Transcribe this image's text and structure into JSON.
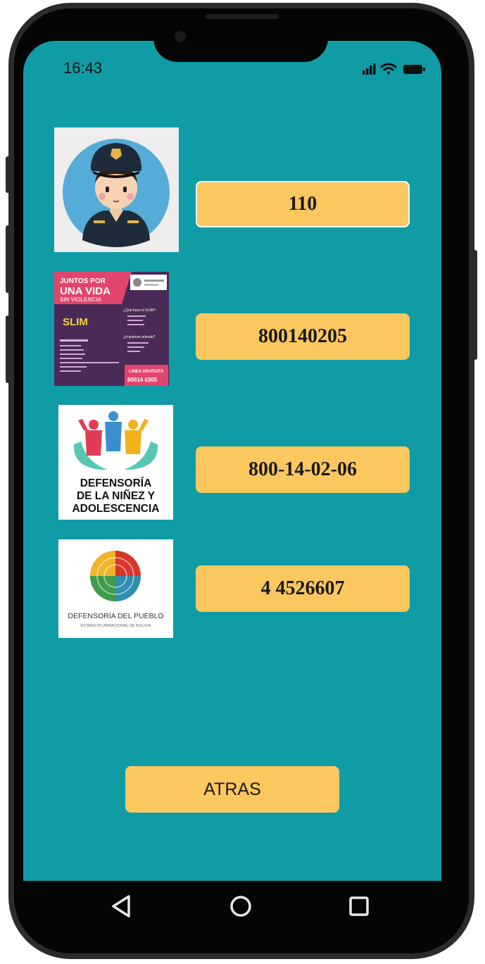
{
  "status_bar": {
    "time": "16:43",
    "icons": [
      "signal-icon",
      "wifi-icon",
      "battery-icon"
    ]
  },
  "contacts": [
    {
      "image": "police-officer-avatar",
      "number": "110"
    },
    {
      "image": "slim-poster",
      "number": "800140205",
      "poster_text": {
        "heading_1": "JUNTOS POR",
        "heading_2": "UNA VIDA",
        "heading_3": "SIN VIOLENCIA",
        "program": "SLIM",
        "question_1": "¿Qué hace el SLIM?",
        "question_2": "¿A quiénes atiende?",
        "hotline_label": "LINEA GRATUITA",
        "hotline_number": "80014 0305"
      }
    },
    {
      "image": "defensoria-ninez-logo",
      "number": "800-14-02-06",
      "logo_text": [
        "DEFENSORÍA",
        "DE LA NIÑEZ Y",
        "ADOLESCENCIA"
      ]
    },
    {
      "image": "defensoria-pueblo-logo",
      "number": "4 4526607",
      "logo_text": "DEFENSORÍA DEL PUEBLO",
      "logo_subtext": "ESTADO PLURINACIONAL DE BOLIVIA"
    }
  ],
  "back_button": "ATRAS",
  "nav_bar": [
    "back-triangle-icon",
    "home-circle-icon",
    "recents-square-icon"
  ],
  "colors": {
    "screen_bg": "#0f9ca5",
    "button_bg": "#fbc75f",
    "phone_frame": "#2b2b2b"
  }
}
